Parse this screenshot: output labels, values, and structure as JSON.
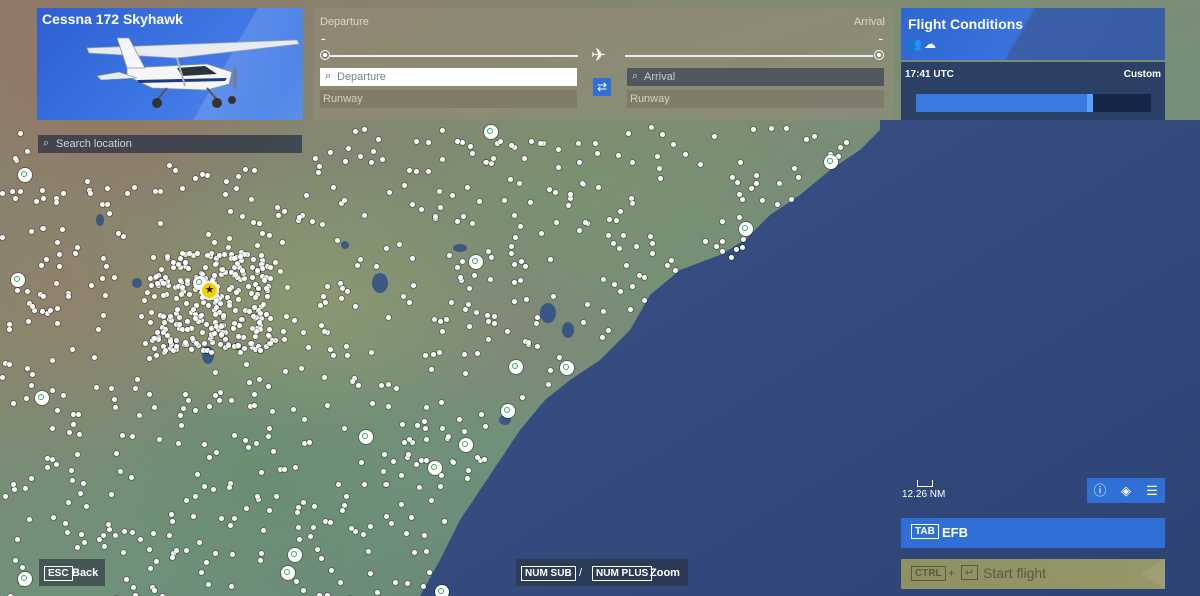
{
  "aircraft": {
    "name": "Cessna 172 Skyhawk"
  },
  "search_location": {
    "placeholder": "Search location",
    "icon": "search-icon"
  },
  "route": {
    "departure_heading": "Departure",
    "arrival_heading": "Arrival",
    "departure_dash": "-",
    "arrival_dash": "-",
    "departure_placeholder": "Departure",
    "arrival_placeholder": "Arrival",
    "departure_runway": "Runway",
    "arrival_runway": "Runway",
    "swap_icon": "swap-icon",
    "plane_icon": "airplane-icon"
  },
  "flight_conditions": {
    "title": "Flight Conditions",
    "time": "17:41 UTC",
    "preset": "Custom",
    "time_of_day_fraction": 0.74
  },
  "map": {
    "scale_label": "12.26 NM",
    "tools": [
      "info-icon",
      "layers-icon",
      "settings-sliders-icon"
    ]
  },
  "efb": {
    "key": "TAB",
    "label": "EFB"
  },
  "start_flight": {
    "key": "CTRL",
    "plus": "+",
    "enter_icon": "enter-key-icon",
    "label": "Start flight"
  },
  "back": {
    "key": "ESC",
    "label": "Back"
  },
  "zoom": {
    "key_out": "NUM SUB",
    "separator": "/",
    "key_in": "NUM PLUS",
    "label": "Zoom"
  },
  "colors": {
    "accent": "#2f6fd6",
    "ocean": "#2e4a7a",
    "favorite": "#f5d000",
    "start_flight_bg": "#b4b05a"
  }
}
